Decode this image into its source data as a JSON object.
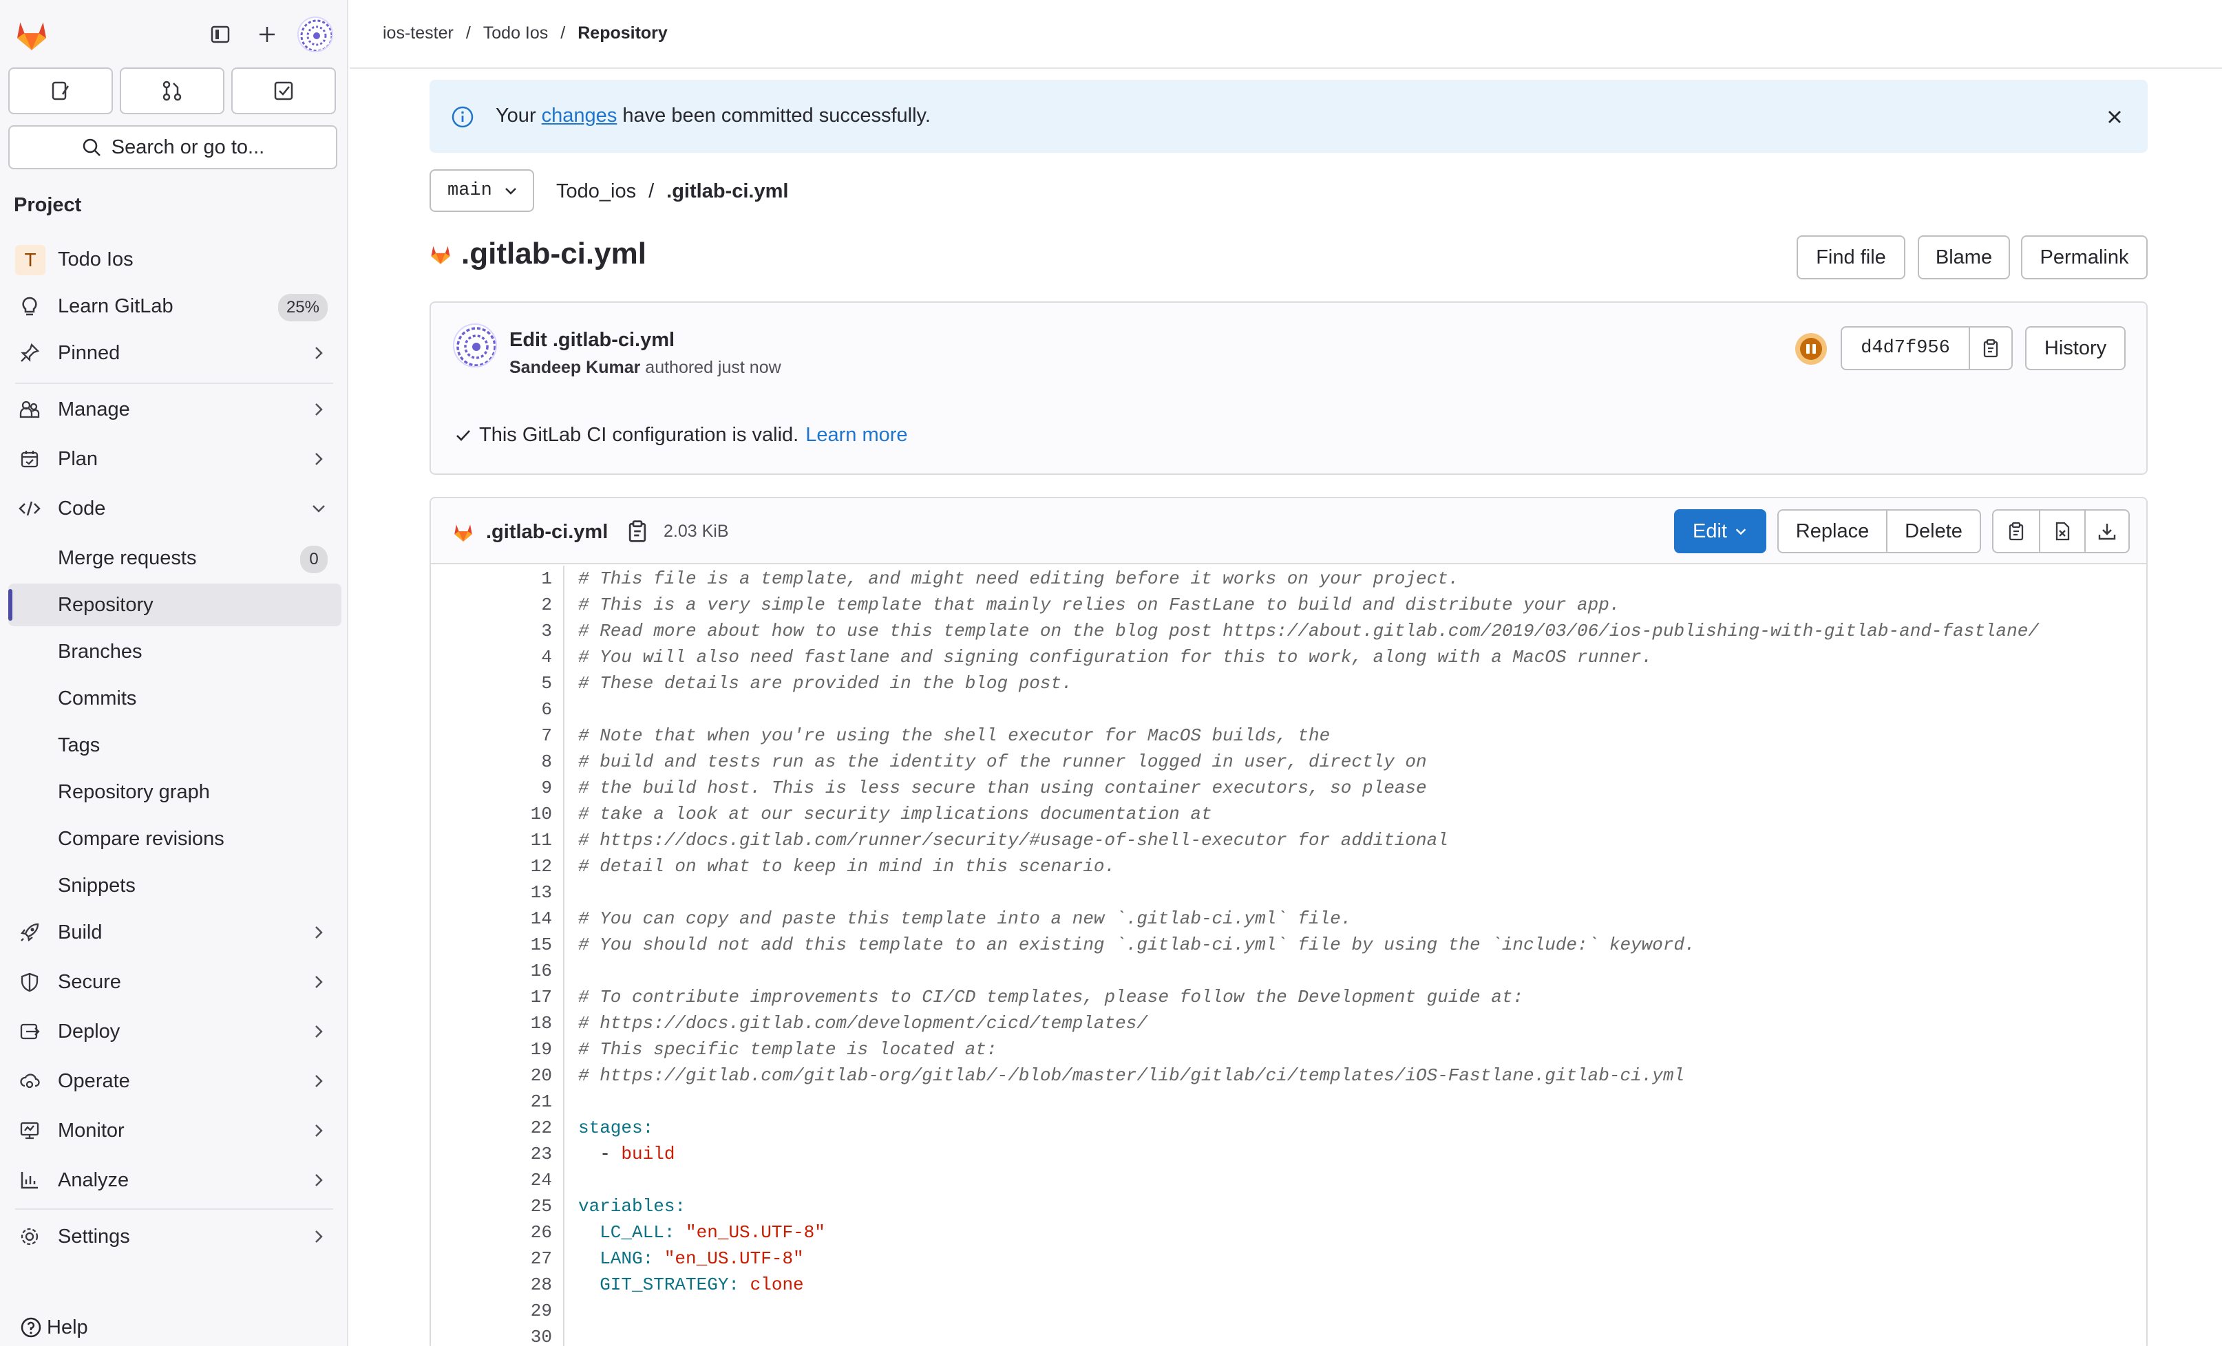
{
  "sidebar": {
    "search_placeholder": "Search or go to...",
    "heading": "Project",
    "project_initial": "T",
    "items": {
      "project": "Todo Ios",
      "learn": "Learn GitLab",
      "learn_badge": "25%",
      "pinned": "Pinned",
      "manage": "Manage",
      "plan": "Plan",
      "code": "Code",
      "merge_requests": "Merge requests",
      "merge_requests_count": "0",
      "repository": "Repository",
      "branches": "Branches",
      "commits": "Commits",
      "tags": "Tags",
      "repository_graph": "Repository graph",
      "compare_revisions": "Compare revisions",
      "snippets": "Snippets",
      "build": "Build",
      "secure": "Secure",
      "deploy": "Deploy",
      "operate": "Operate",
      "monitor": "Monitor",
      "analyze": "Analyze",
      "settings": "Settings"
    },
    "help": "Help"
  },
  "breadcrumb": {
    "group": "ios-tester",
    "project": "Todo Ios",
    "current": "Repository",
    "sep": "/"
  },
  "alert": {
    "prefix": "Your",
    "link": "changes",
    "suffix": "have been committed successfully."
  },
  "repo": {
    "branch": "main",
    "path_root": "Todo_ios",
    "path_sep": "/",
    "path_file": ".gitlab-ci.yml",
    "file_title": ".gitlab-ci.yml",
    "buttons": {
      "find_file": "Find file",
      "blame": "Blame",
      "permalink": "Permalink"
    }
  },
  "commit": {
    "title": "Edit .gitlab-ci.yml",
    "author": "Sandeep Kumar",
    "authored": "authored just now",
    "sha": "d4d7f956",
    "history": "History",
    "ci_valid": "This GitLab CI configuration is valid.",
    "learn_more": "Learn more"
  },
  "file": {
    "name": ".gitlab-ci.yml",
    "size": "2.03 KiB",
    "edit": "Edit",
    "replace": "Replace",
    "delete": "Delete"
  },
  "code_lines": [
    {
      "n": "1",
      "t": "# This file is a template, and might need editing before it works on your project.",
      "k": "cmt"
    },
    {
      "n": "2",
      "t": "# This is a very simple template that mainly relies on FastLane to build and distribute your app.",
      "k": "cmt"
    },
    {
      "n": "3",
      "t": "# Read more about how to use this template on the blog post https://about.gitlab.com/2019/03/06/ios-publishing-with-gitlab-and-fastlane/",
      "k": "cmt"
    },
    {
      "n": "4",
      "t": "# You will also need fastlane and signing configuration for this to work, along with a MacOS runner.",
      "k": "cmt"
    },
    {
      "n": "5",
      "t": "# These details are provided in the blog post.",
      "k": "cmt"
    },
    {
      "n": "6",
      "t": "",
      "k": "plain"
    },
    {
      "n": "7",
      "t": "# Note that when you're using the shell executor for MacOS builds, the",
      "k": "cmt"
    },
    {
      "n": "8",
      "t": "# build and tests run as the identity of the runner logged in user, directly on",
      "k": "cmt"
    },
    {
      "n": "9",
      "t": "# the build host. This is less secure than using container executors, so please",
      "k": "cmt"
    },
    {
      "n": "10",
      "t": "# take a look at our security implications documentation at",
      "k": "cmt"
    },
    {
      "n": "11",
      "t": "# https://docs.gitlab.com/runner/security/#usage-of-shell-executor for additional",
      "k": "cmt"
    },
    {
      "n": "12",
      "t": "# detail on what to keep in mind in this scenario.",
      "k": "cmt"
    },
    {
      "n": "13",
      "t": "",
      "k": "plain"
    },
    {
      "n": "14",
      "t": "# You can copy and paste this template into a new `.gitlab-ci.yml` file.",
      "k": "cmt"
    },
    {
      "n": "15",
      "t": "# You should not add this template to an existing `.gitlab-ci.yml` file by using the `include:` keyword.",
      "k": "cmt"
    },
    {
      "n": "16",
      "t": "",
      "k": "plain"
    },
    {
      "n": "17",
      "t": "# To contribute improvements to CI/CD templates, please follow the Development guide at:",
      "k": "cmt"
    },
    {
      "n": "18",
      "t": "# https://docs.gitlab.com/development/cicd/templates/",
      "k": "cmt"
    },
    {
      "n": "19",
      "t": "# This specific template is located at:",
      "k": "cmt"
    },
    {
      "n": "20",
      "t": "# https://gitlab.com/gitlab-org/gitlab/-/blob/master/lib/gitlab/ci/templates/iOS-Fastlane.gitlab-ci.yml",
      "k": "cmt"
    },
    {
      "n": "21",
      "t": "",
      "k": "plain"
    },
    {
      "n": "22",
      "t": "stages:",
      "k": "key"
    },
    {
      "n": "23",
      "t": "  - build",
      "k": "list"
    },
    {
      "n": "24",
      "t": "",
      "k": "plain"
    },
    {
      "n": "25",
      "t": "variables:",
      "k": "key"
    },
    {
      "n": "26",
      "t": "  LC_ALL: \"en_US.UTF-8\"",
      "k": "kv"
    },
    {
      "n": "27",
      "t": "  LANG: \"en_US.UTF-8\"",
      "k": "kv"
    },
    {
      "n": "28",
      "t": "  GIT_STRATEGY: clone",
      "k": "kv"
    },
    {
      "n": "29",
      "t": "",
      "k": "plain"
    },
    {
      "n": "30",
      "t": "",
      "k": "plain"
    }
  ],
  "colors": {
    "accent": "#1f75cb",
    "alert_bg": "#e9f3fc",
    "pipeline": "#c46a08",
    "sidebar_bg": "#f7f6f8"
  }
}
